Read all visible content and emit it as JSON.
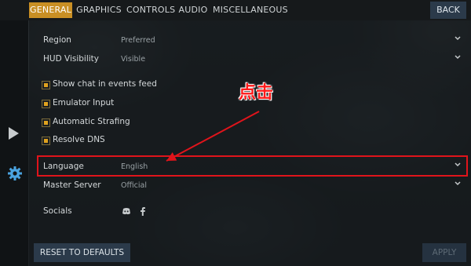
{
  "tabs": [
    {
      "label": "GENERAL",
      "active": true
    },
    {
      "label": "GRAPHICS",
      "active": false
    },
    {
      "label": "CONTROLS",
      "active": false
    },
    {
      "label": "AUDIO",
      "active": false
    },
    {
      "label": "MISCELLANEOUS",
      "active": false
    }
  ],
  "back_label": "BACK",
  "settings": {
    "region": {
      "label": "Region",
      "value": "Preferred"
    },
    "hud": {
      "label": "HUD Visibility",
      "value": "Visible"
    },
    "language": {
      "label": "Language",
      "value": "English"
    },
    "master_server": {
      "label": "Master Server",
      "value": "Official"
    }
  },
  "checkboxes": [
    {
      "label": "Show chat in events feed",
      "checked": true
    },
    {
      "label": "Emulator Input",
      "checked": true
    },
    {
      "label": "Automatic Strafing",
      "checked": true
    },
    {
      "label": "Resolve DNS",
      "checked": true
    }
  ],
  "socials": {
    "label": "Socials",
    "icons": [
      "discord-icon",
      "facebook-icon"
    ]
  },
  "buttons": {
    "reset": "RESET TO DEFAULTS",
    "apply": "APPLY"
  },
  "annotation": {
    "text": "点击"
  },
  "colors": {
    "accent": "#c98f24",
    "checkbox": "#e0a21e",
    "annotation": "#e0141b",
    "button": "#2b3a4a"
  }
}
